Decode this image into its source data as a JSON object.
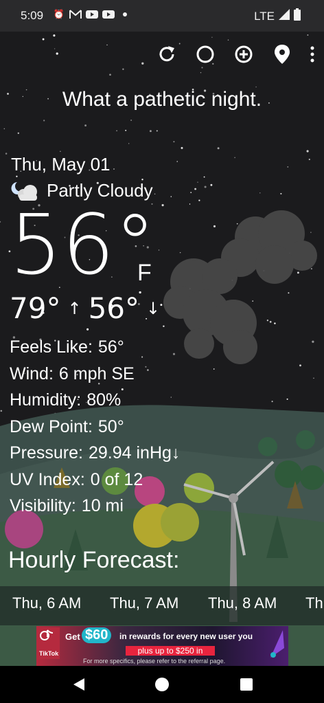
{
  "status_bar": {
    "time": "5:09",
    "notification_icons": [
      "alarm-icon",
      "gmail-icon",
      "youtube-icon",
      "youtube-icon",
      "dot-icon"
    ],
    "network": "LTE",
    "right_icons": [
      "signal-icon",
      "battery-icon"
    ]
  },
  "toolbar": {
    "buttons": [
      "refresh-icon",
      "theme-icon",
      "add-icon",
      "location-icon",
      "more-icon"
    ]
  },
  "headline": "What a pathetic night.",
  "current": {
    "date": "Thu, May 01",
    "condition": "Partly Cloudy",
    "condition_icon": "partly-cloudy-night-icon",
    "temperature": "56°",
    "unit": "F",
    "high": "79°",
    "low": "56°",
    "high_arrow": "↑",
    "low_arrow": "↓"
  },
  "details": [
    {
      "label": "Feels Like:",
      "value": "56°"
    },
    {
      "label": "Wind:",
      "value": "6 mph SE"
    },
    {
      "label": "Humidity:",
      "value": "80%"
    },
    {
      "label": "Dew Point:",
      "value": "50°"
    },
    {
      "label": "Pressure:",
      "value": "29.94 inHg↓"
    },
    {
      "label": "UV Index:",
      "value": "0 of 12"
    },
    {
      "label": "Visibility:",
      "value": "10 mi"
    }
  ],
  "hourly": {
    "title": "Hourly Forecast:",
    "items": [
      "Thu, 6 AM",
      "Thu, 7 AM",
      "Thu, 8 AM",
      "Th"
    ]
  },
  "ad": {
    "brand": "TikTok",
    "get": "Get",
    "amount": "$60",
    "main_text": "in rewards for every new user you",
    "plus_text": "plus up to $250 in",
    "footnote": "For more specifics, please refer to the referral page."
  },
  "navbar": {
    "buttons": [
      "back-icon",
      "home-icon",
      "recents-icon"
    ]
  },
  "colors": {
    "sky": "#1b1b1d",
    "status_bar": "#2a2a2c",
    "hills": "#3d4f4a",
    "hourly_strip": "#202c28",
    "ad_red": "#e8243e",
    "ad_cyan": "#21b6c9"
  }
}
